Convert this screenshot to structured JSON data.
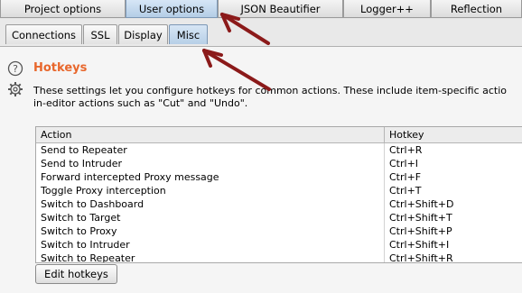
{
  "top_tabs": [
    {
      "label": "Project options"
    },
    {
      "label": "User options"
    },
    {
      "label": "JSON Beautifier"
    },
    {
      "label": "Logger++"
    },
    {
      "label": "Reflection"
    }
  ],
  "sub_tabs": [
    {
      "label": "Connections"
    },
    {
      "label": "SSL"
    },
    {
      "label": "Display"
    },
    {
      "label": "Misc"
    }
  ],
  "section": {
    "title": "Hotkeys",
    "description_line1": "These settings let you configure hotkeys for common actions. These include item-specific actio",
    "description_line2": "in-editor actions such as \"Cut\" and \"Undo\"."
  },
  "table": {
    "columns": [
      "Action",
      "Hotkey"
    ],
    "rows": [
      {
        "action": "Send to Repeater",
        "hotkey": "Ctrl+R"
      },
      {
        "action": "Send to Intruder",
        "hotkey": "Ctrl+I"
      },
      {
        "action": "Forward intercepted Proxy message",
        "hotkey": "Ctrl+F"
      },
      {
        "action": "Toggle Proxy interception",
        "hotkey": "Ctrl+T"
      },
      {
        "action": "Switch to Dashboard",
        "hotkey": "Ctrl+Shift+D"
      },
      {
        "action": "Switch to Target",
        "hotkey": "Ctrl+Shift+T"
      },
      {
        "action": "Switch to Proxy",
        "hotkey": "Ctrl+Shift+P"
      },
      {
        "action": "Switch to Intruder",
        "hotkey": "Ctrl+Shift+I"
      },
      {
        "action": "Switch to Repeater",
        "hotkey": "Ctrl+Shift+R"
      }
    ]
  },
  "edit_button_label": "Edit hotkeys",
  "colors": {
    "accent": "#e8672c",
    "annotation_arrow": "#8b1a1a"
  },
  "icons": {
    "help": "help-circle-icon",
    "settings": "gear-icon"
  }
}
